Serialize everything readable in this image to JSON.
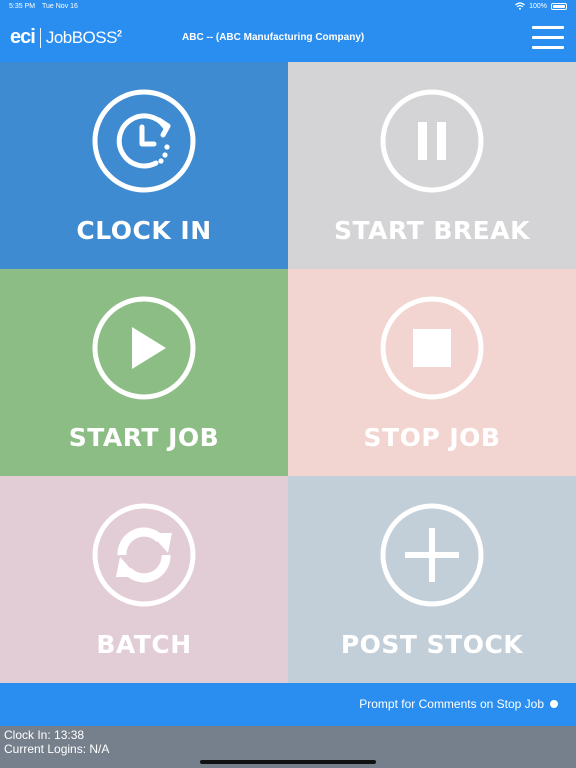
{
  "status_bar": {
    "time": "5:35 PM",
    "date": "Tue Nov 16",
    "battery": "100%"
  },
  "header": {
    "logo_eci": "eci",
    "logo_product": "JobBOSS",
    "logo_superscript": "2",
    "company": "ABC -- (ABC Manufacturing Company)"
  },
  "tiles": [
    {
      "label": "CLOCK IN",
      "icon": "clock-in-icon",
      "color": "#3f8bd1"
    },
    {
      "label": "START BREAK",
      "icon": "pause-icon",
      "color": "#d4d4d6"
    },
    {
      "label": "START JOB",
      "icon": "play-icon",
      "color": "#8cbd84"
    },
    {
      "label": "STOP JOB",
      "icon": "stop-icon",
      "color": "#f2d5d1"
    },
    {
      "label": "BATCH",
      "icon": "refresh-icon",
      "color": "#e2ccd6"
    },
    {
      "label": "POST STOCK",
      "icon": "plus-icon",
      "color": "#c2cfd9"
    }
  ],
  "prompt": {
    "label": "Prompt for Comments on Stop Job"
  },
  "footer": {
    "clock_in": "Clock In: 13:38",
    "current_logins": "Current Logins: N/A"
  },
  "colors": {
    "accent": "#2a8ef0",
    "footer_bg": "#76808c"
  }
}
